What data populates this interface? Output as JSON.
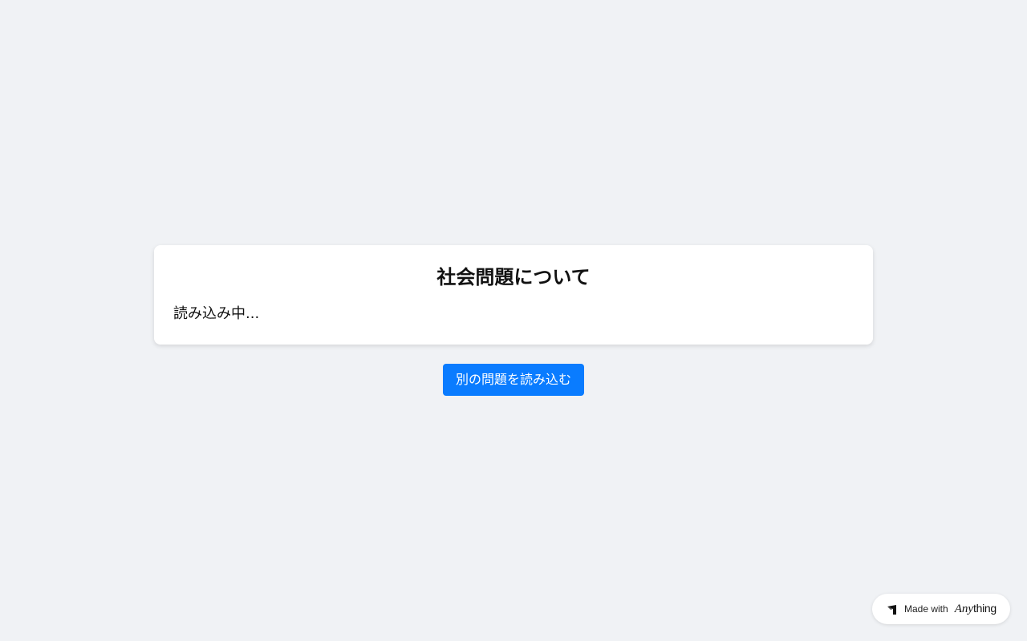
{
  "card": {
    "title": "社会問題について",
    "status": "読み込み中..."
  },
  "actions": {
    "reload_label": "別の問題を読み込む"
  },
  "badge": {
    "prefix": "Made with",
    "brand_italic": "Any",
    "brand_rest": "thing",
    "icon": "anything-logo-icon"
  },
  "colors": {
    "background": "#f0f2f5",
    "card": "#ffffff",
    "button": "#0a7cff",
    "button_text": "#ffffff"
  }
}
